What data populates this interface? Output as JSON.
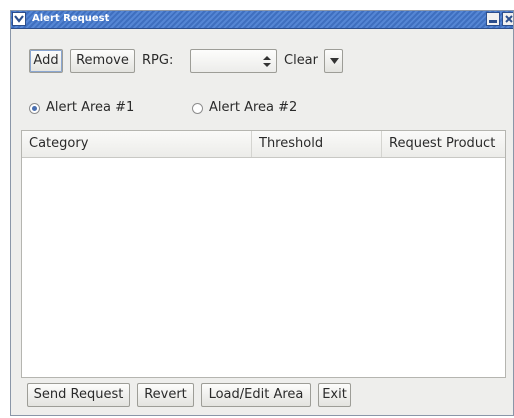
{
  "window": {
    "title": "Alert Request"
  },
  "toolbar": {
    "add_label": "Add",
    "remove_label": "Remove",
    "rpg_label": "RPG:",
    "rpg_value": "",
    "clear_label": "Clear"
  },
  "alert_areas": [
    {
      "label": "Alert Area #1",
      "checked": true
    },
    {
      "label": "Alert Area #2",
      "checked": false
    }
  ],
  "table": {
    "columns": [
      "Category",
      "Threshold",
      "Request Product"
    ],
    "rows": []
  },
  "footer": {
    "send_label": "Send Request",
    "revert_label": "Revert",
    "load_edit_label": "Load/Edit Area",
    "exit_label": "Exit"
  },
  "colors": {
    "titlebar": "#4a79c8",
    "window_bg": "#eeeeec",
    "radio_selected": "#4a6fb0"
  },
  "icons": [
    "window-menu-icon",
    "minimize-icon",
    "close-icon",
    "spinner-arrows-icon",
    "dropdown-arrow-icon"
  ]
}
